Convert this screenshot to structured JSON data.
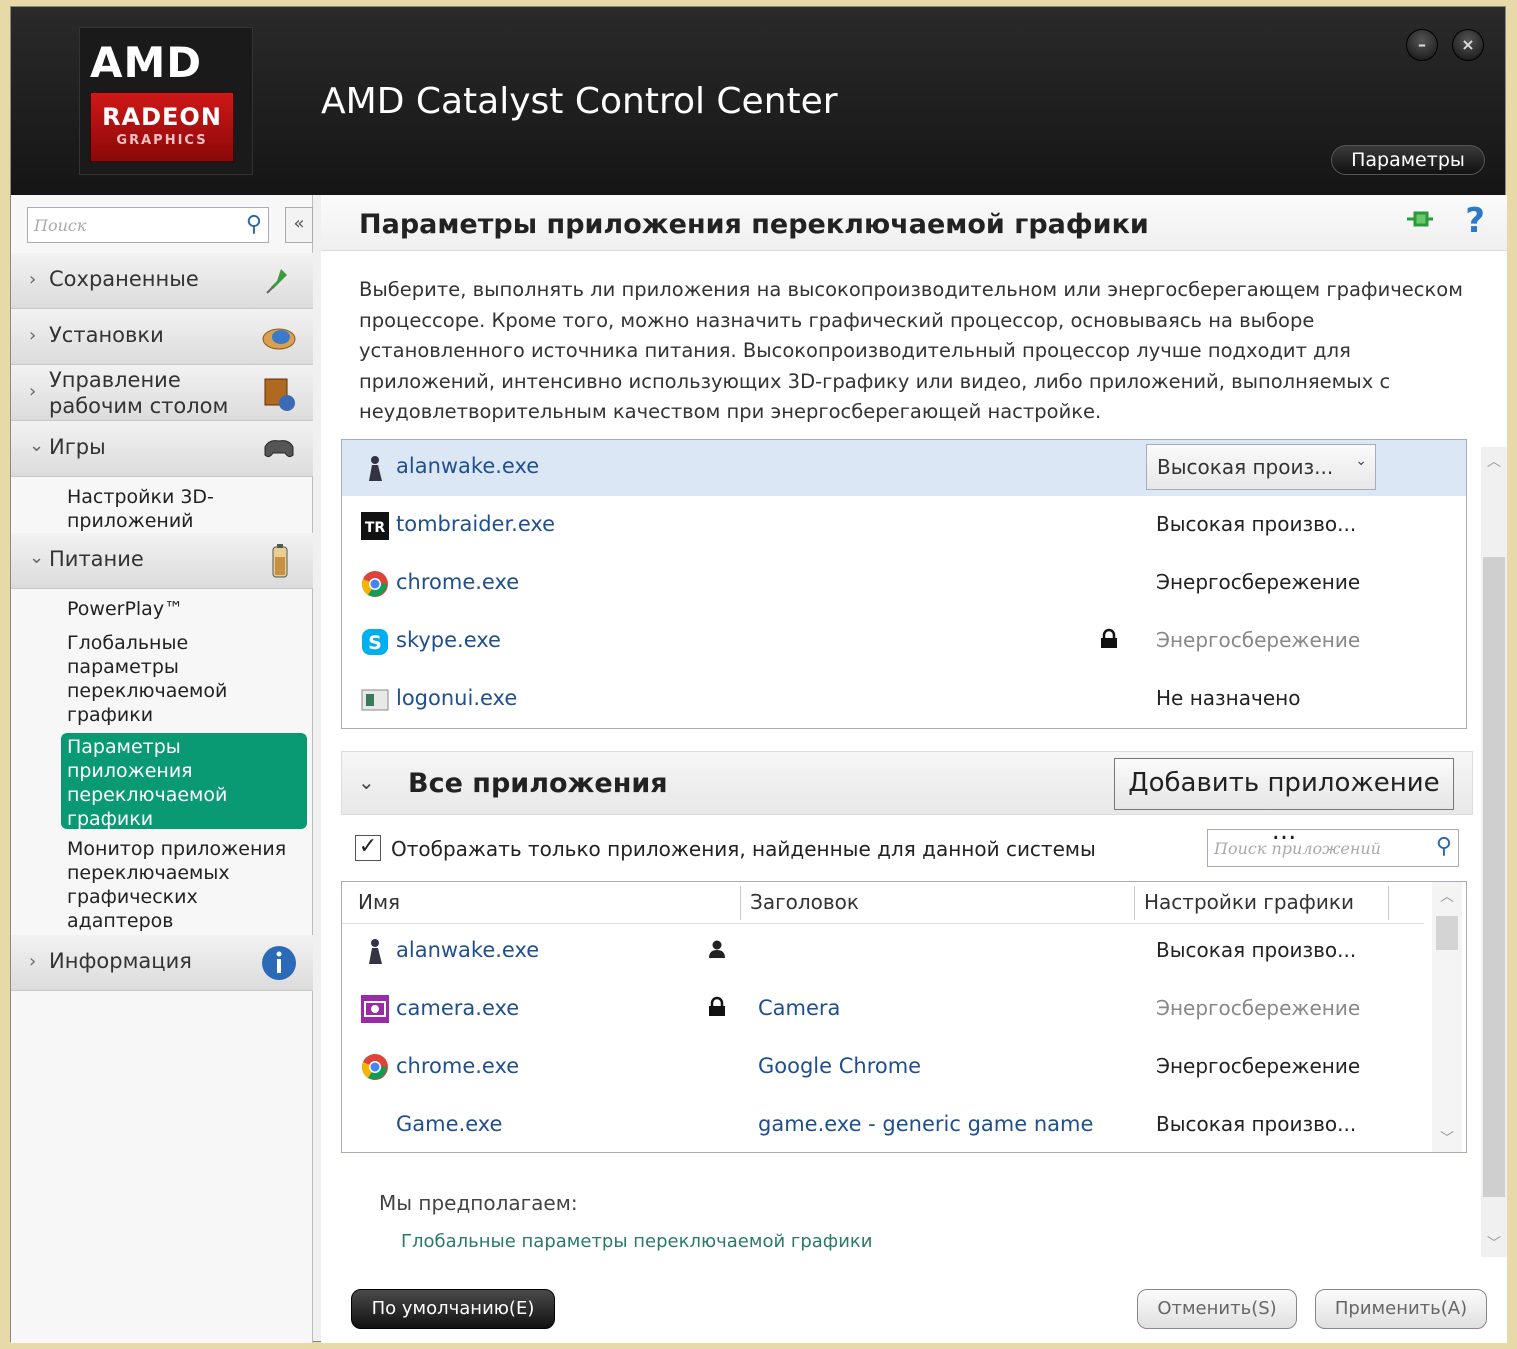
{
  "window": {
    "title": "AMD Catalyst Control Center",
    "logo_amd": "AMD",
    "logo_radeon": "RADEON",
    "logo_graphics": "GRAPHICS",
    "params_button": "Параметры",
    "minimize_glyph": "–",
    "close_glyph": "×"
  },
  "sidebar": {
    "search_placeholder": "Поиск",
    "collapse_glyph": "«",
    "sections": [
      {
        "label": "Сохраненные",
        "expanded": false
      },
      {
        "label": "Установки",
        "expanded": false
      },
      {
        "label": "Управление рабочим столом",
        "expanded": false
      },
      {
        "label": "Игры",
        "expanded": true
      },
      {
        "label": "Питание",
        "expanded": true
      },
      {
        "label": "Информация",
        "expanded": false
      }
    ],
    "section_lines": {
      "desktop_1": "Управление",
      "desktop_2": "рабочим столом"
    },
    "games_items": [
      {
        "label_1": "Настройки 3D-",
        "label_2": "приложений"
      }
    ],
    "power_items": [
      {
        "label": "PowerPlay™"
      },
      {
        "label_1": "Глобальные",
        "label_2": "параметры",
        "label_3": "переключаемой",
        "label_4": "графики"
      },
      {
        "label_1": "Параметры",
        "label_2": "приложения",
        "label_3": "переключаемой",
        "label_4": "графики",
        "active": true
      },
      {
        "label_1": "Монитор приложения",
        "label_2": "переключаемых",
        "label_3": "графических",
        "label_4": "адаптеров"
      }
    ]
  },
  "main": {
    "title": "Параметры приложения переключаемой графики",
    "help_glyph": "?",
    "description": "Выберите, выполнять ли приложения на высокопроизводительном или энергосберегающем графическом процессоре. Кроме того, можно назначить графический процессор, основываясь на выборе установленного источника питания. Высокопроизводительный процессор лучше подходит для приложений, интенсивно использующих 3D-графику или видео, либо приложений, выполняемых с неудовлетворительным качеством при энергосберегающей настройке.",
    "recent_apps": [
      {
        "name": "alanwake.exe",
        "setting": "Высокая произ...",
        "selected": true,
        "icon": "alanwake-icon"
      },
      {
        "name": "tombraider.exe",
        "setting": "Высокая произво...",
        "icon": "tombraider-icon"
      },
      {
        "name": "chrome.exe",
        "setting": "Энергосбережение",
        "icon": "chrome-icon"
      },
      {
        "name": "skype.exe",
        "setting": "Энергосбережение",
        "locked": true,
        "dim": true,
        "icon": "skype-icon"
      },
      {
        "name": "logonui.exe",
        "setting": "Не назначено",
        "icon": "logonui-icon"
      }
    ],
    "all_apps": {
      "label": "Все приложения",
      "add_button": "Добавить приложение ...",
      "checkbox_label": "Отображать только приложения, найденные для данной системы",
      "checkbox_checked": true,
      "checkbox_glyph": "✓",
      "search_placeholder": "Поиск приложений",
      "columns": [
        "Имя",
        "Заголовок",
        "Настройки графики"
      ],
      "rows": [
        {
          "name": "alanwake.exe",
          "title": "",
          "setting": "Высокая произво...",
          "badge": "user-icon",
          "icon": "alanwake-icon"
        },
        {
          "name": "camera.exe",
          "title": "Camera",
          "setting": "Энергосбережение",
          "badge": "lock-icon",
          "dim": true,
          "icon": "camera-icon"
        },
        {
          "name": "chrome.exe",
          "title": "Google Chrome",
          "setting": "Энергосбережение",
          "icon": "chrome-icon"
        },
        {
          "name": "Game.exe",
          "title": "game.exe - generic game name",
          "setting": "Высокая произво..."
        }
      ]
    },
    "suggest_label": "Мы предполагаем:",
    "suggest_link": "Глобальные параметры переключаемой графики"
  },
  "footer": {
    "default_button": "По умолчанию(E)",
    "cancel_button": "Отменить(S)",
    "apply_button": "Применить(A)"
  },
  "colors": {
    "active_item": "#0a9a73",
    "link": "#1f4f8f",
    "header_bg": "#151515",
    "brand_red": "#d01818"
  }
}
